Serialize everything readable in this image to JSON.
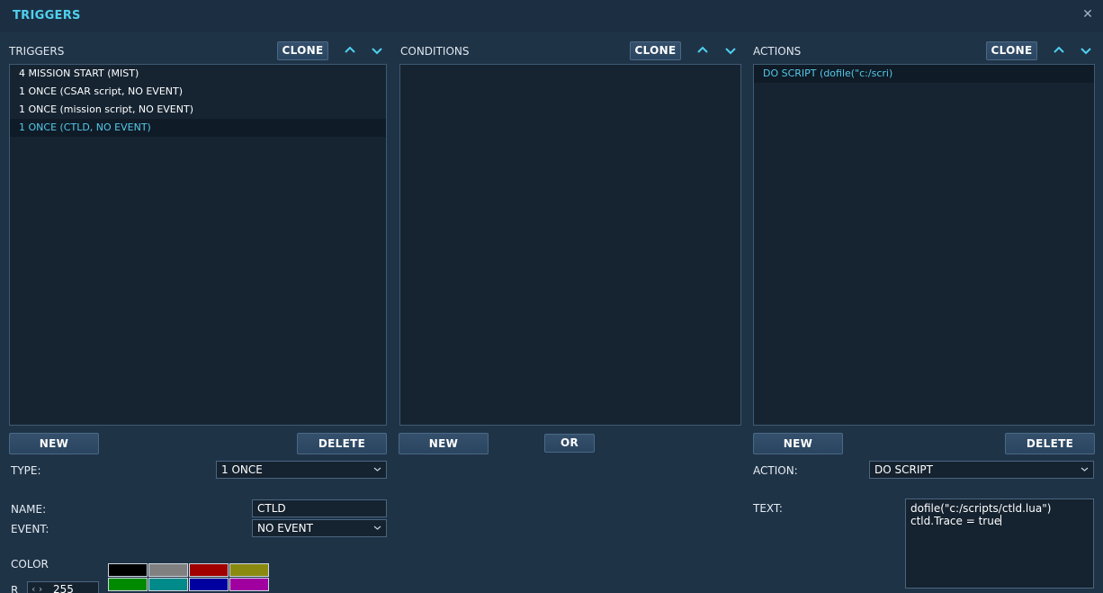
{
  "window": {
    "title": "TRIGGERS"
  },
  "triggers": {
    "header": "TRIGGERS",
    "clone_label": "CLONE",
    "items": [
      "4 MISSION START (MIST)",
      "1 ONCE (CSAR script, NO EVENT)",
      "1 ONCE (mission script, NO EVENT)",
      "1 ONCE (CTLD, NO EVENT)"
    ],
    "selected_index": 3,
    "new_label": "NEW",
    "delete_label": "DELETE"
  },
  "conditions": {
    "header": "CONDITIONS",
    "clone_label": "CLONE",
    "new_label": "NEW",
    "or_label": "OR"
  },
  "actions": {
    "header": "ACTIONS",
    "clone_label": "CLONE",
    "items": [
      "DO SCRIPT (dofile(\"c:/scri)"
    ],
    "selected_index": 0,
    "new_label": "NEW",
    "delete_label": "DELETE"
  },
  "form": {
    "type_label": "TYPE:",
    "type_value": "1 ONCE",
    "name_label": "NAME:",
    "name_value": "CTLD",
    "event_label": "EVENT:",
    "event_value": "NO EVENT",
    "color_label": "COLOR",
    "r_label": "R",
    "r_value": "255",
    "action_label": "ACTION:",
    "action_value": "DO SCRIPT",
    "text_label": "TEXT:",
    "text_lines": [
      "dofile(\"c:/scripts/ctld.lua\")",
      "ctld.Trace = true"
    ]
  },
  "colors": {
    "accent": "#4fd1ee",
    "swatches": [
      "#000000",
      "#808080",
      "#a00000",
      "#8a8a10",
      "#008a00",
      "#008a8a",
      "#0000a0",
      "#a000a0"
    ]
  }
}
